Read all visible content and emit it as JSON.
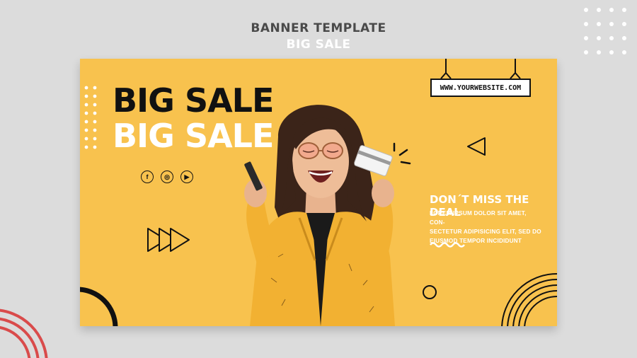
{
  "header": {
    "line1": "BANNER TEMPLATE",
    "line2": "BIG SALE"
  },
  "banner": {
    "headline_dark": "BIG SALE",
    "headline_light": "BIG SALE",
    "website": "WWW.YOURWEBSITE.COM",
    "deal_title": "DON´T MISS THE DEAL",
    "deal_lines": [
      "LOREM IPSUM DOLOR SIT AMET, CON-",
      "SECTETUR ADIPISICING ELIT, SED DO",
      "EIUSMOD TEMPOR INCIDIDUNT"
    ],
    "social": [
      {
        "icon": "facebook-icon",
        "glyph": "f"
      },
      {
        "icon": "instagram-icon",
        "glyph": "◎"
      },
      {
        "icon": "youtube-icon",
        "glyph": "▶"
      }
    ]
  },
  "colors": {
    "banner_bg": "#f8c24e",
    "page_bg": "#dcdcdc",
    "accent_dark": "#111111",
    "jacket": "#f2b132"
  }
}
